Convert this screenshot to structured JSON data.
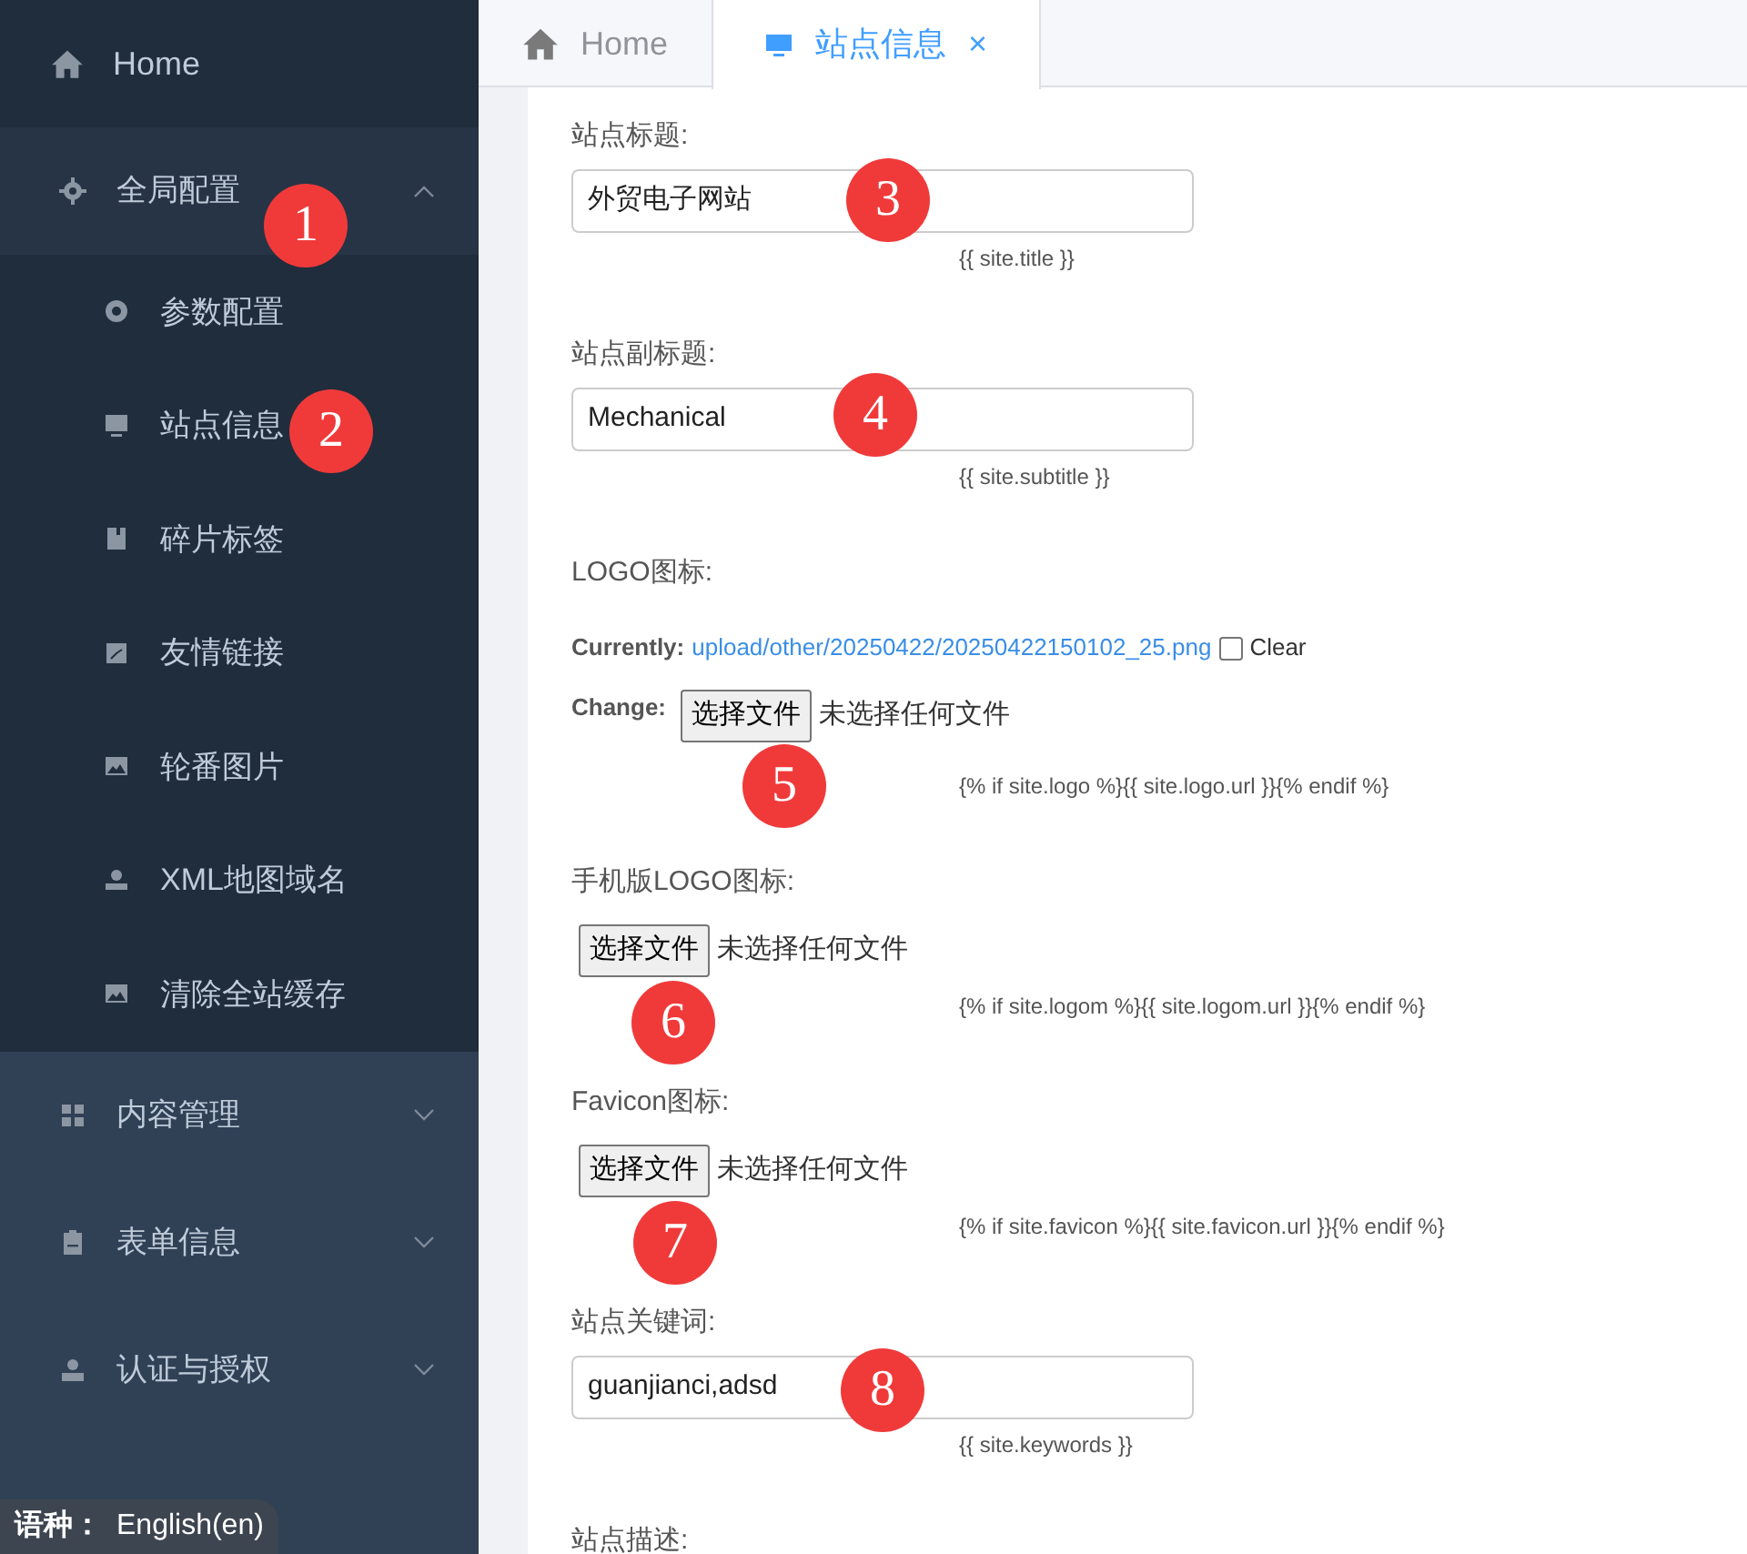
{
  "sidebar": {
    "items": [
      {
        "kind": "link",
        "label": "Home"
      },
      {
        "kind": "group",
        "label": "全局配置",
        "expanded": true,
        "children": [
          {
            "label": "参数配置"
          },
          {
            "label": "站点信息"
          },
          {
            "label": "碎片标签"
          },
          {
            "label": "友情链接"
          },
          {
            "label": "轮番图片"
          },
          {
            "label": "XML地图域名"
          },
          {
            "label": "清除全站缓存"
          }
        ]
      },
      {
        "kind": "group",
        "label": "内容管理",
        "expanded": false
      },
      {
        "kind": "group",
        "label": "表单信息",
        "expanded": false
      },
      {
        "kind": "group",
        "label": "认证与授权",
        "expanded": false
      }
    ]
  },
  "language_badge": {
    "label": "语种：",
    "value": "English(en)"
  },
  "tabs": [
    {
      "label": "Home",
      "selected": false
    },
    {
      "label": "站点信息",
      "selected": true,
      "close": "×"
    }
  ],
  "form": {
    "fields": [
      {
        "kind": "text",
        "label": "站点标题:",
        "value": "外贸电子网站",
        "hint": "{{ site.title }}"
      },
      {
        "kind": "text",
        "label": "站点副标题:",
        "value": "Mechanical",
        "hint": "{{ site.subtitle }}"
      },
      {
        "kind": "image",
        "label": "LOGO图标:",
        "current_label": "Currently:",
        "current_link": "upload/other/20250422/20250422150102_25.png",
        "clear_label": "Clear",
        "clear_checked": false,
        "change_label": "Change:",
        "button": "选择文件",
        "file_status": "未选择任何文件",
        "hint": "{% if site.logo %}{{ site.logo.url }}{% endif %}"
      },
      {
        "kind": "file",
        "label": "手机版LOGO图标:",
        "button": "选择文件",
        "file_status": "未选择任何文件",
        "hint": "{% if site.logom %}{{ site.logom.url }}{% endif %}"
      },
      {
        "kind": "file",
        "label": "Favicon图标:",
        "button": "选择文件",
        "file_status": "未选择任何文件",
        "hint": "{% if site.favicon %}{{ site.favicon.url }}{% endif %}"
      },
      {
        "kind": "text",
        "label": "站点关键词:",
        "value": "guanjianci,adsd",
        "hint": "{{ site.keywords }}"
      },
      {
        "kind": "heading",
        "label": "站点描述:"
      }
    ]
  },
  "markers": [
    "1",
    "2",
    "3",
    "4",
    "5",
    "6",
    "7",
    "8"
  ]
}
